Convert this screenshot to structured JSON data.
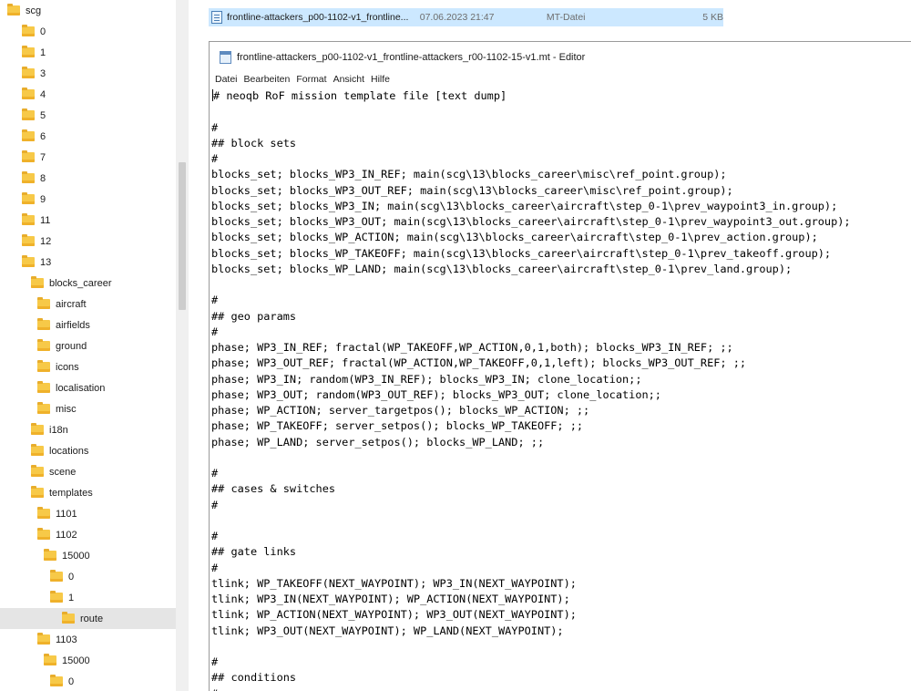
{
  "tree": {
    "items": [
      {
        "label": "scg",
        "level": 0
      },
      {
        "label": "0",
        "level": 1
      },
      {
        "label": "1",
        "level": 1
      },
      {
        "label": "3",
        "level": 1
      },
      {
        "label": "4",
        "level": 1
      },
      {
        "label": "5",
        "level": 1
      },
      {
        "label": "6",
        "level": 1
      },
      {
        "label": "7",
        "level": 1
      },
      {
        "label": "8",
        "level": 1
      },
      {
        "label": "9",
        "level": 1
      },
      {
        "label": "11",
        "level": 1
      },
      {
        "label": "12",
        "level": 1
      },
      {
        "label": "13",
        "level": 1
      },
      {
        "label": "blocks_career",
        "level": 2
      },
      {
        "label": "aircraft",
        "level": 3
      },
      {
        "label": "airfields",
        "level": 3
      },
      {
        "label": "ground",
        "level": 3
      },
      {
        "label": "icons",
        "level": 3
      },
      {
        "label": "localisation",
        "level": 3
      },
      {
        "label": "misc",
        "level": 3
      },
      {
        "label": "i18n",
        "level": 2
      },
      {
        "label": "locations",
        "level": 2
      },
      {
        "label": "scene",
        "level": 2
      },
      {
        "label": "templates",
        "level": 2
      },
      {
        "label": "1101",
        "level": 3
      },
      {
        "label": "1102",
        "level": 3
      },
      {
        "label": "15000",
        "level": 4
      },
      {
        "label": "0",
        "level": 5
      },
      {
        "label": "1",
        "level": 5
      },
      {
        "label": "route",
        "level": 6,
        "selected": true
      },
      {
        "label": "1103",
        "level": 3
      },
      {
        "label": "15000",
        "level": 4
      },
      {
        "label": "0",
        "level": 5
      }
    ]
  },
  "file": {
    "name": "frontline-attackers_p00-1102-v1_frontline...",
    "date": "07.06.2023 21:47",
    "type": "MT-Datei",
    "size": "5 KB"
  },
  "editor": {
    "title": "frontline-attackers_p00-1102-v1_frontline-attackers_r00-1102-15-v1.mt - Editor",
    "menu": [
      "Datei",
      "Bearbeiten",
      "Format",
      "Ansicht",
      "Hilfe"
    ],
    "lines": [
      "# neoqb RoF mission template file [text dump]",
      "",
      "#",
      "## block sets",
      "#",
      "blocks_set; blocks_WP3_IN_REF; main(scg\\13\\blocks_career\\misc\\ref_point.group);",
      "blocks_set; blocks_WP3_OUT_REF; main(scg\\13\\blocks_career\\misc\\ref_point.group);",
      "blocks_set; blocks_WP3_IN; main(scg\\13\\blocks_career\\aircraft\\step_0-1\\prev_waypoint3_in.group);",
      "blocks_set; blocks_WP3_OUT; main(scg\\13\\blocks_career\\aircraft\\step_0-1\\prev_waypoint3_out.group);",
      "blocks_set; blocks_WP_ACTION; main(scg\\13\\blocks_career\\aircraft\\step_0-1\\prev_action.group);",
      "blocks_set; blocks_WP_TAKEOFF; main(scg\\13\\blocks_career\\aircraft\\step_0-1\\prev_takeoff.group);",
      "blocks_set; blocks_WP_LAND; main(scg\\13\\blocks_career\\aircraft\\step_0-1\\prev_land.group);",
      "",
      "#",
      "## geo params",
      "#",
      "phase; WP3_IN_REF; fractal(WP_TAKEOFF,WP_ACTION,0,1,both); blocks_WP3_IN_REF; ;;",
      "phase; WP3_OUT_REF; fractal(WP_ACTION,WP_TAKEOFF,0,1,left); blocks_WP3_OUT_REF; ;;",
      "phase; WP3_IN; random(WP3_IN_REF); blocks_WP3_IN; clone_location;;",
      "phase; WP3_OUT; random(WP3_OUT_REF); blocks_WP3_OUT; clone_location;;",
      "phase; WP_ACTION; server_targetpos(); blocks_WP_ACTION; ;;",
      "phase; WP_TAKEOFF; server_setpos(); blocks_WP_TAKEOFF; ;;",
      "phase; WP_LAND; server_setpos(); blocks_WP_LAND; ;;",
      "",
      "#",
      "## cases & switches",
      "#",
      "",
      "#",
      "## gate links",
      "#",
      "tlink; WP_TAKEOFF(NEXT_WAYPOINT); WP3_IN(NEXT_WAYPOINT);",
      "tlink; WP3_IN(NEXT_WAYPOINT); WP_ACTION(NEXT_WAYPOINT);",
      "tlink; WP_ACTION(NEXT_WAYPOINT); WP3_OUT(NEXT_WAYPOINT);",
      "tlink; WP3_OUT(NEXT_WAYPOINT); WP_LAND(NEXT_WAYPOINT);",
      "",
      "#",
      "## conditions",
      "#"
    ]
  }
}
